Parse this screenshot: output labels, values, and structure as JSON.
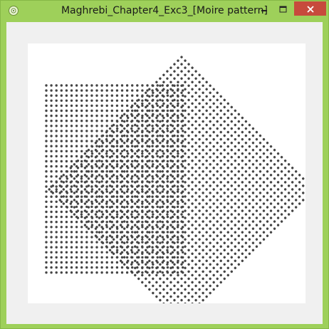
{
  "window": {
    "title": "Maghrebi_Chapter4_Exc3_[Moire pattern]",
    "frame_color": "#9ed05a",
    "close_color": "#c74a3c"
  },
  "titlebar": {
    "app_icon": "app-icon",
    "minimize_icon": "minimize-icon",
    "maximize_icon": "maximize-icon",
    "close_icon": "close-icon"
  },
  "canvas": {
    "background": "#ffffff",
    "dot_color": "#444444",
    "grids": [
      {
        "name": "axis-aligned dot grid",
        "rotation_deg": 0
      },
      {
        "name": "rotated dot grid",
        "rotation_deg": 45
      }
    ]
  }
}
